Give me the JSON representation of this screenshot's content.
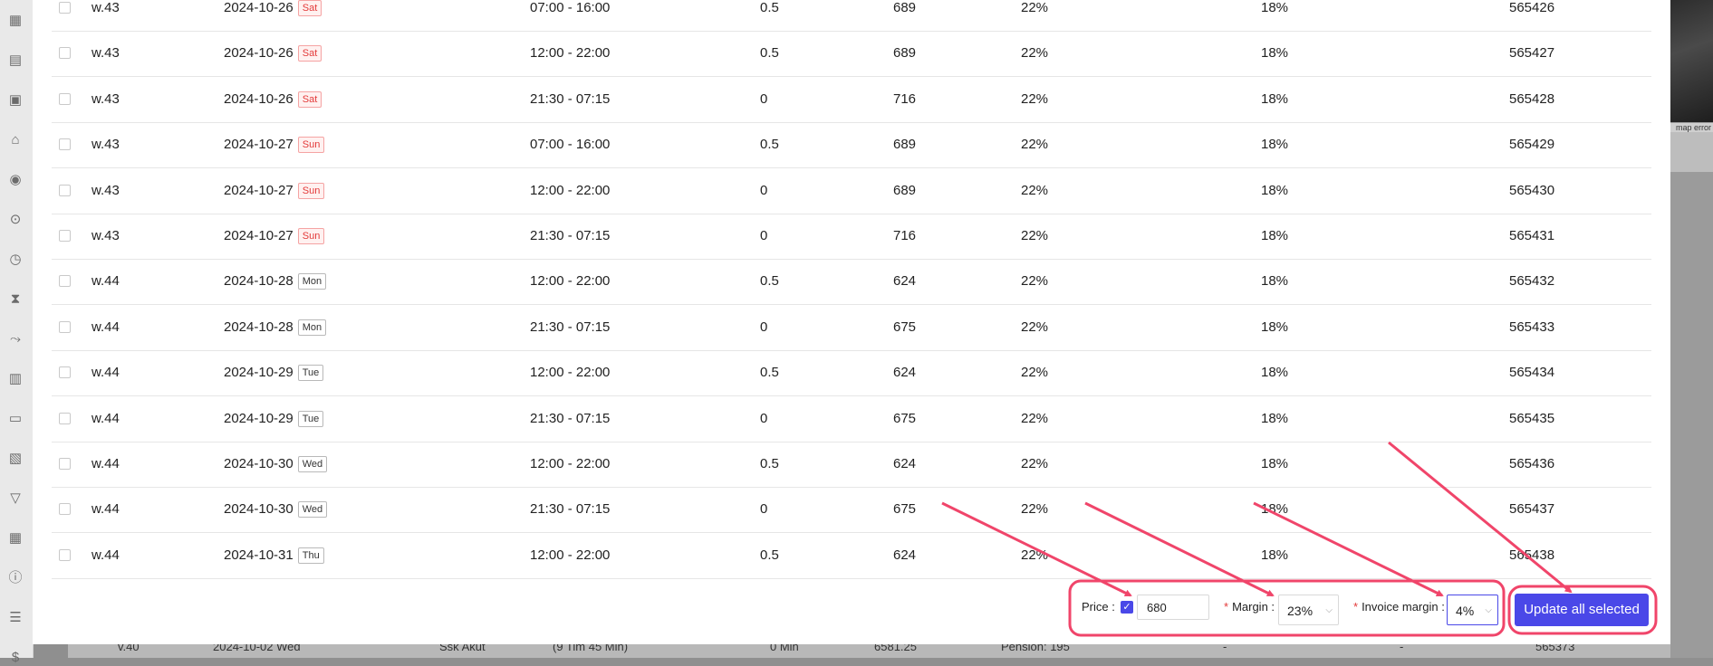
{
  "sidebar": {
    "icons": [
      "calendar-icon",
      "document-icon",
      "briefcase-icon",
      "home-icon",
      "user-icon",
      "location-icon",
      "clock-icon",
      "hourglass-icon",
      "route-icon",
      "report-icon",
      "wallet-icon",
      "invoice-icon",
      "filter-icon",
      "grid-icon",
      "info-icon",
      "list-icon",
      "dollar-icon"
    ]
  },
  "background": {
    "map_error": "map error",
    "bottom_row": [
      "v.40",
      "2024-10-02 Wed",
      "Ssk Akut",
      "(9 Tim 45 Min)",
      "0 Min",
      "6581.25",
      "Pension: 195",
      "-",
      "-",
      "565373"
    ]
  },
  "table": {
    "rows": [
      {
        "week": "w.43",
        "date": "2024-10-26",
        "day": "Sat",
        "weekend": true,
        "time": "07:00 - 16:00",
        "factor": "0.5",
        "price": "689",
        "margin": "22%",
        "invoice_margin": "18%",
        "id": "565426"
      },
      {
        "week": "w.43",
        "date": "2024-10-26",
        "day": "Sat",
        "weekend": true,
        "time": "12:00 - 22:00",
        "factor": "0.5",
        "price": "689",
        "margin": "22%",
        "invoice_margin": "18%",
        "id": "565427"
      },
      {
        "week": "w.43",
        "date": "2024-10-26",
        "day": "Sat",
        "weekend": true,
        "time": "21:30 - 07:15",
        "factor": "0",
        "price": "716",
        "margin": "22%",
        "invoice_margin": "18%",
        "id": "565428"
      },
      {
        "week": "w.43",
        "date": "2024-10-27",
        "day": "Sun",
        "weekend": true,
        "time": "07:00 - 16:00",
        "factor": "0.5",
        "price": "689",
        "margin": "22%",
        "invoice_margin": "18%",
        "id": "565429"
      },
      {
        "week": "w.43",
        "date": "2024-10-27",
        "day": "Sun",
        "weekend": true,
        "time": "12:00 - 22:00",
        "factor": "0",
        "price": "689",
        "margin": "22%",
        "invoice_margin": "18%",
        "id": "565430"
      },
      {
        "week": "w.43",
        "date": "2024-10-27",
        "day": "Sun",
        "weekend": true,
        "time": "21:30 - 07:15",
        "factor": "0",
        "price": "716",
        "margin": "22%",
        "invoice_margin": "18%",
        "id": "565431"
      },
      {
        "week": "w.44",
        "date": "2024-10-28",
        "day": "Mon",
        "weekend": false,
        "time": "12:00 - 22:00",
        "factor": "0.5",
        "price": "624",
        "margin": "22%",
        "invoice_margin": "18%",
        "id": "565432"
      },
      {
        "week": "w.44",
        "date": "2024-10-28",
        "day": "Mon",
        "weekend": false,
        "time": "21:30 - 07:15",
        "factor": "0",
        "price": "675",
        "margin": "22%",
        "invoice_margin": "18%",
        "id": "565433"
      },
      {
        "week": "w.44",
        "date": "2024-10-29",
        "day": "Tue",
        "weekend": false,
        "time": "12:00 - 22:00",
        "factor": "0.5",
        "price": "624",
        "margin": "22%",
        "invoice_margin": "18%",
        "id": "565434"
      },
      {
        "week": "w.44",
        "date": "2024-10-29",
        "day": "Tue",
        "weekend": false,
        "time": "21:30 - 07:15",
        "factor": "0",
        "price": "675",
        "margin": "22%",
        "invoice_margin": "18%",
        "id": "565435"
      },
      {
        "week": "w.44",
        "date": "2024-10-30",
        "day": "Wed",
        "weekend": false,
        "time": "12:00 - 22:00",
        "factor": "0.5",
        "price": "624",
        "margin": "22%",
        "invoice_margin": "18%",
        "id": "565436"
      },
      {
        "week": "w.44",
        "date": "2024-10-30",
        "day": "Wed",
        "weekend": false,
        "time": "21:30 - 07:15",
        "factor": "0",
        "price": "675",
        "margin": "22%",
        "invoice_margin": "18%",
        "id": "565437"
      },
      {
        "week": "w.44",
        "date": "2024-10-31",
        "day": "Thu",
        "weekend": false,
        "time": "12:00 - 22:00",
        "factor": "0.5",
        "price": "624",
        "margin": "22%",
        "invoice_margin": "18%",
        "id": "565438"
      }
    ]
  },
  "footer": {
    "price_label": "Price :",
    "price_checked": true,
    "price_value": "680",
    "margin_required": "*",
    "margin_label": "Margin :",
    "margin_value": "23%",
    "invoice_required": "*",
    "invoice_margin_label": "Invoice margin :",
    "invoice_margin_value": "4%",
    "update_button": "Update all selected"
  },
  "colors": {
    "accent": "#4a48e8",
    "weekend_tag": "#e33a3a",
    "annotation": "#f0456a"
  }
}
